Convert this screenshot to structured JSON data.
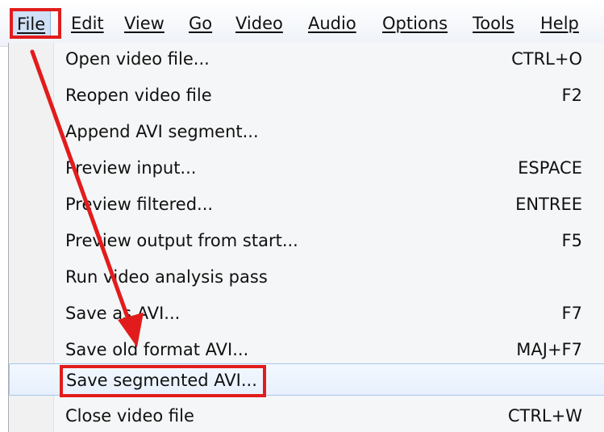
{
  "menubar": {
    "items": [
      {
        "label": "File"
      },
      {
        "label": "Edit"
      },
      {
        "label": "View"
      },
      {
        "label": "Go"
      },
      {
        "label": "Video"
      },
      {
        "label": "Audio"
      },
      {
        "label": "Options"
      },
      {
        "label": "Tools"
      },
      {
        "label": "Help"
      }
    ]
  },
  "file_menu": {
    "items": [
      {
        "label": "Open video file...",
        "shortcut": "CTRL+O"
      },
      {
        "label": "Reopen video file",
        "shortcut": "F2"
      },
      {
        "label": "Append AVI segment...",
        "shortcut": ""
      },
      {
        "label": "Preview input...",
        "shortcut": "ESPACE"
      },
      {
        "label": "Preview filtered...",
        "shortcut": "ENTREE"
      },
      {
        "label": "Preview output from start...",
        "shortcut": "F5"
      },
      {
        "label": "Run video analysis pass",
        "shortcut": ""
      },
      {
        "label": "Save as AVI...",
        "shortcut": "F7"
      },
      {
        "label": "Save old format AVI...",
        "shortcut": "MAJ+F7"
      },
      {
        "label": "Save segmented AVI...",
        "shortcut": ""
      },
      {
        "label": "Close video file",
        "shortcut": "CTRL+W"
      }
    ]
  },
  "annotation": {
    "color": "#e21c1c"
  }
}
